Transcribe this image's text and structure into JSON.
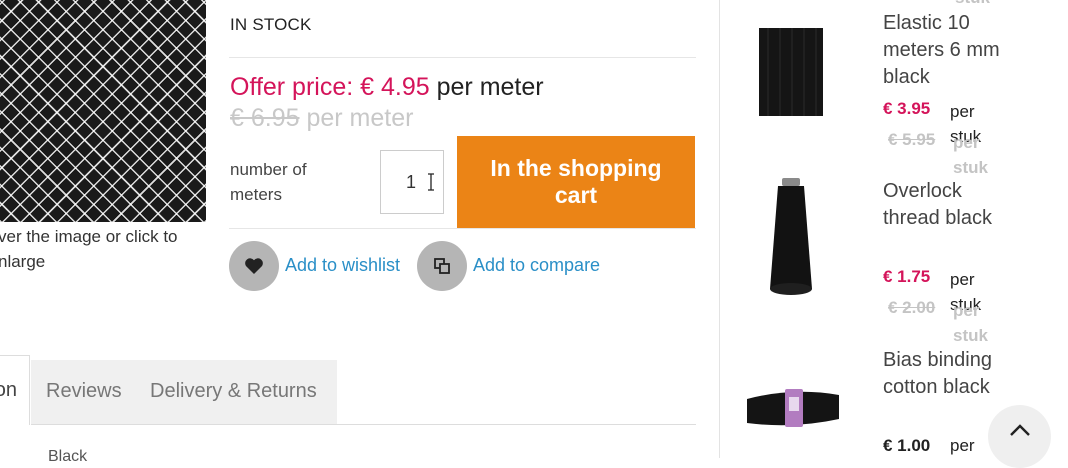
{
  "product": {
    "stock_status": "IN STOCK",
    "image_hint": "ver the image or click to nlarge",
    "offer_label": "Offer price: € 4.95",
    "offer_unit": "per meter",
    "old_price": "€ 6.95",
    "old_unit": "per meter",
    "quantity_label": "number of meters",
    "quantity_value": "1",
    "cart_button": "In the shopping cart",
    "wishlist_link": "Add to wishlist",
    "compare_link": "Add to compare"
  },
  "tabs": {
    "active_partial": "on",
    "items": [
      "Reviews",
      "Delivery & Returns"
    ],
    "description_partial": "Black"
  },
  "sidebar": {
    "top_cut_text": "stuk",
    "items": [
      {
        "name": "Elastic 10 meters 6 mm black",
        "price": "€ 3.95",
        "price_unit": "per stuk",
        "old_price": "€ 5.95",
        "old_unit": "per stuk"
      },
      {
        "name": "Overlock thread black",
        "price": "€ 1.75",
        "price_unit": "per stuk",
        "old_price": "€ 2.00",
        "old_unit": "per stuk"
      },
      {
        "name": "Bias binding cotton black",
        "price": "€ 1.00",
        "price_unit": "per"
      }
    ]
  },
  "colors": {
    "accent_orange": "#eb8416",
    "price_pink": "#d4145a",
    "link_blue": "#2a8fc7"
  },
  "icons": [
    "heart-icon",
    "compare-icon",
    "text-cursor-icon",
    "chevron-up-icon"
  ]
}
